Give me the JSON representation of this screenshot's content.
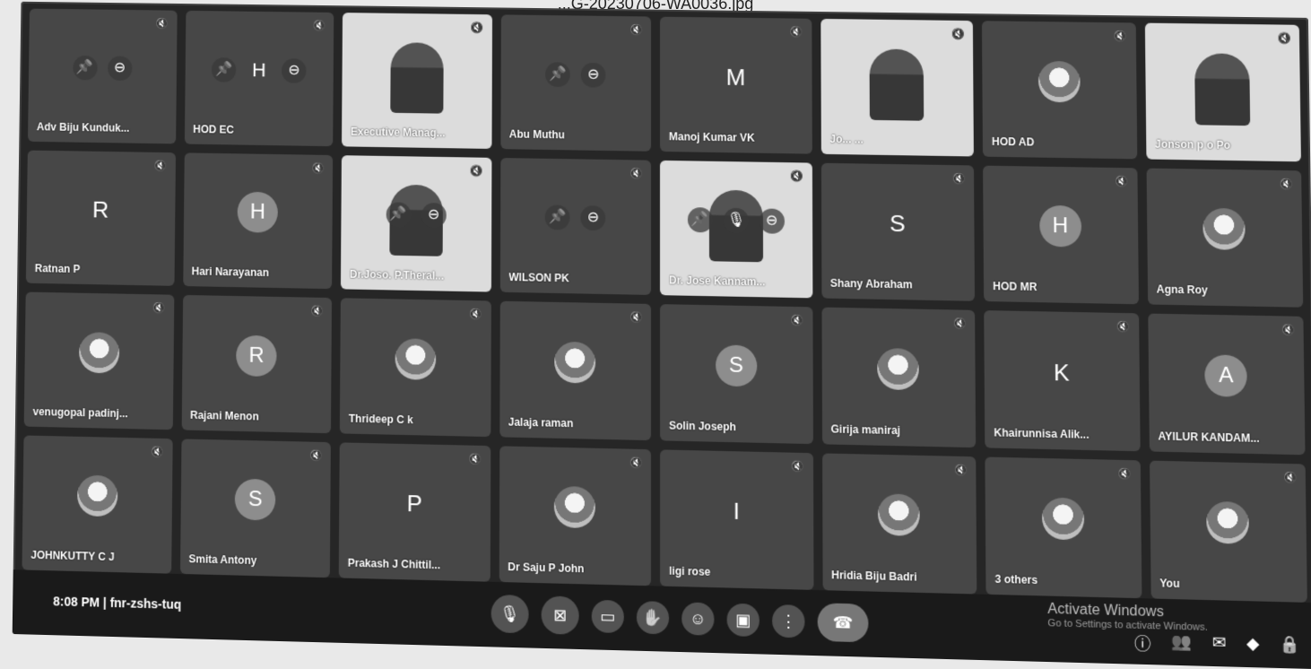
{
  "file_name": "...G-20230706-WA0036.jpg",
  "meeting": {
    "time": "8:08 PM",
    "separator": "|",
    "code": "fnr-zshs-tuq"
  },
  "tiles": [
    {
      "name": "Adv Biju Kunduk...",
      "avatar": "",
      "type": "hover"
    },
    {
      "name": "HOD EC",
      "avatar": "H",
      "type": "hover"
    },
    {
      "name": "Executive Manag...",
      "avatar": "",
      "type": "video"
    },
    {
      "name": "Abu Muthu",
      "avatar": "",
      "type": "hover"
    },
    {
      "name": "Manoj Kumar VK",
      "avatar": "M",
      "type": "letter-plain"
    },
    {
      "name": "Jo... ...",
      "avatar": "",
      "type": "video"
    },
    {
      "name": "HOD AD",
      "avatar": "",
      "type": "photo"
    },
    {
      "name": "Jonson p o Po",
      "avatar": "",
      "type": "video"
    },
    {
      "name": "Ratnan P",
      "avatar": "R",
      "type": "letter-plain"
    },
    {
      "name": "Hari Narayanan",
      "avatar": "H",
      "type": "letter"
    },
    {
      "name": "Dr.Joso. P.Theral...",
      "avatar": "",
      "type": "video-hover"
    },
    {
      "name": "WILSON PK",
      "avatar": "",
      "type": "hover"
    },
    {
      "name": "Dr. Jose Kannam...",
      "avatar": "",
      "type": "video-hover3"
    },
    {
      "name": "Shany Abraham",
      "avatar": "S",
      "type": "letter-plain"
    },
    {
      "name": "HOD MR",
      "avatar": "H",
      "type": "letter"
    },
    {
      "name": "Agna Roy",
      "avatar": "",
      "type": "photo"
    },
    {
      "name": "venugopal padinj...",
      "avatar": "",
      "type": "photo"
    },
    {
      "name": "Rajani Menon",
      "avatar": "R",
      "type": "letter"
    },
    {
      "name": "Thrideep C k",
      "avatar": "",
      "type": "photo"
    },
    {
      "name": "Jalaja raman",
      "avatar": "",
      "type": "photo"
    },
    {
      "name": "Solin Joseph",
      "avatar": "S",
      "type": "letter"
    },
    {
      "name": "Girija maniraj",
      "avatar": "",
      "type": "photo"
    },
    {
      "name": "Khairunnisa Alik...",
      "avatar": "K",
      "type": "letter-plain"
    },
    {
      "name": "AYILUR KANDAM...",
      "avatar": "A",
      "type": "letter"
    },
    {
      "name": "JOHNKUTTY C J",
      "avatar": "",
      "type": "photo"
    },
    {
      "name": "Smita Antony",
      "avatar": "S",
      "type": "letter"
    },
    {
      "name": "Prakash J Chittil...",
      "avatar": "P",
      "type": "letter-plain"
    },
    {
      "name": "Dr Saju P John",
      "avatar": "",
      "type": "photo"
    },
    {
      "name": "ligi rose",
      "avatar": "I",
      "type": "letter-plain"
    },
    {
      "name": "Hridia Biju Badri",
      "avatar": "",
      "type": "photo"
    },
    {
      "name": "3 others",
      "avatar": "",
      "type": "photo"
    },
    {
      "name": "You",
      "avatar": "",
      "type": "photo"
    }
  ],
  "icons": {
    "muted": "mic-off-icon",
    "pin": "pin-icon",
    "remove": "remove-icon",
    "mic": "mic-icon"
  },
  "watermark": {
    "line1": "Activate Windows",
    "line2": "Go to Settings to activate Windows."
  }
}
